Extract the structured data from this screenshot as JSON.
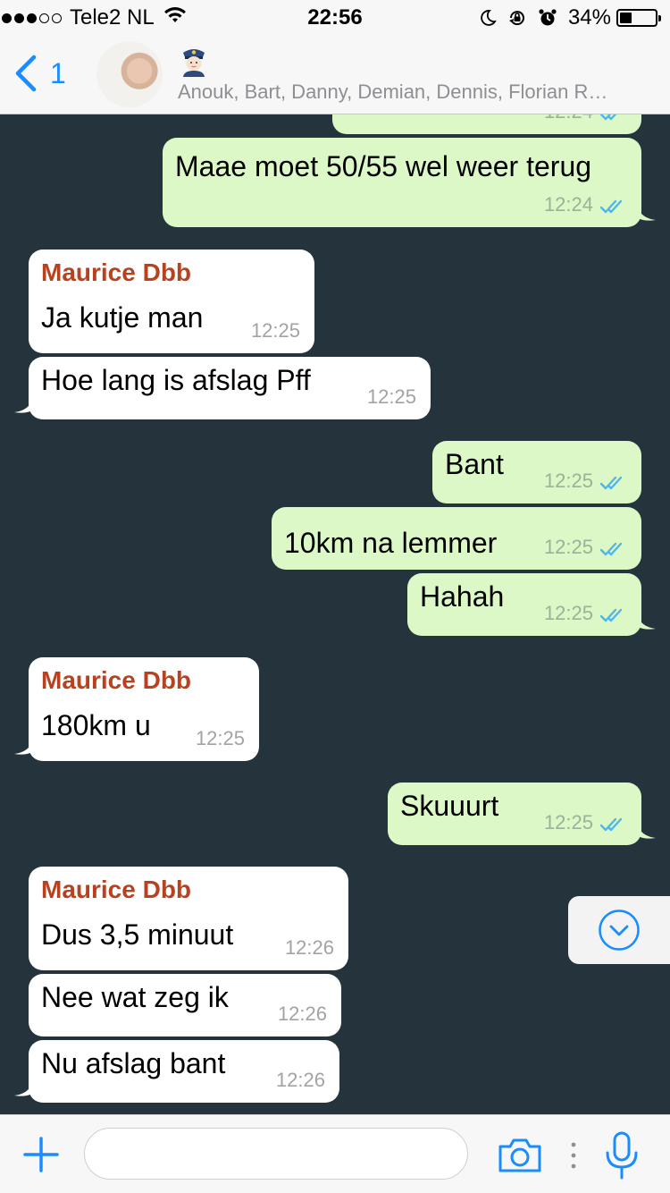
{
  "status_bar": {
    "carrier": "Tele2 NL",
    "time": "22:56",
    "battery_percent": "34%",
    "battery_level": 0.34,
    "signal_bars": 3,
    "signal_max": 5
  },
  "header": {
    "back_count": "1",
    "group_icon": "police-officer-emoji-icon",
    "members": "Anouk, Bart, Danny, Demian, Dennis, Florian R…"
  },
  "messages": [
    {
      "dir": "out",
      "text": "",
      "time": "12:24",
      "ticks": true,
      "partial": true
    },
    {
      "dir": "out",
      "text": "Maae moet 50/55 wel weer terug",
      "time": "12:24",
      "ticks": true
    },
    {
      "dir": "in",
      "sender": "Maurice Dbb",
      "text": "Ja kutje man",
      "time": "12:25"
    },
    {
      "dir": "in",
      "text": "Hoe lang is afslag Pff",
      "time": "12:25"
    },
    {
      "dir": "out",
      "text": "Bant",
      "time": "12:25",
      "ticks": true
    },
    {
      "dir": "out",
      "text": "10km na lemmer",
      "time": "12:25",
      "ticks": true
    },
    {
      "dir": "out",
      "text": "Hahah",
      "time": "12:25",
      "ticks": true
    },
    {
      "dir": "in",
      "sender": "Maurice Dbb",
      "text": "180km u",
      "time": "12:25"
    },
    {
      "dir": "out",
      "text": "Skuuurt",
      "time": "12:25",
      "ticks": true
    },
    {
      "dir": "in",
      "sender": "Maurice Dbb",
      "text": "Dus 3,5 minuut",
      "time": "12:26"
    },
    {
      "dir": "in",
      "text": "Nee wat zeg ik",
      "time": "12:26"
    },
    {
      "dir": "in",
      "text": "Nu afslag bant",
      "time": "12:26"
    }
  ],
  "input_bar": {
    "placeholder": "",
    "value": ""
  },
  "colors": {
    "chat_background": "#24333c",
    "outgoing_bubble": "#dcf8c6",
    "incoming_bubble": "#ffffff",
    "sender_name": "#b8421f",
    "accent": "#1a8cff",
    "read_ticks": "#4fb6ec"
  },
  "icons": {
    "back": "chevron-left-icon",
    "wifi": "wifi-icon",
    "moon": "moon-icon",
    "rotation_lock": "rotation-lock-icon",
    "alarm": "alarm-icon",
    "scroll_down": "chevron-down-circle-icon",
    "attach": "plus-icon",
    "camera": "camera-icon",
    "more": "vertical-dots-icon",
    "mic": "microphone-icon"
  }
}
